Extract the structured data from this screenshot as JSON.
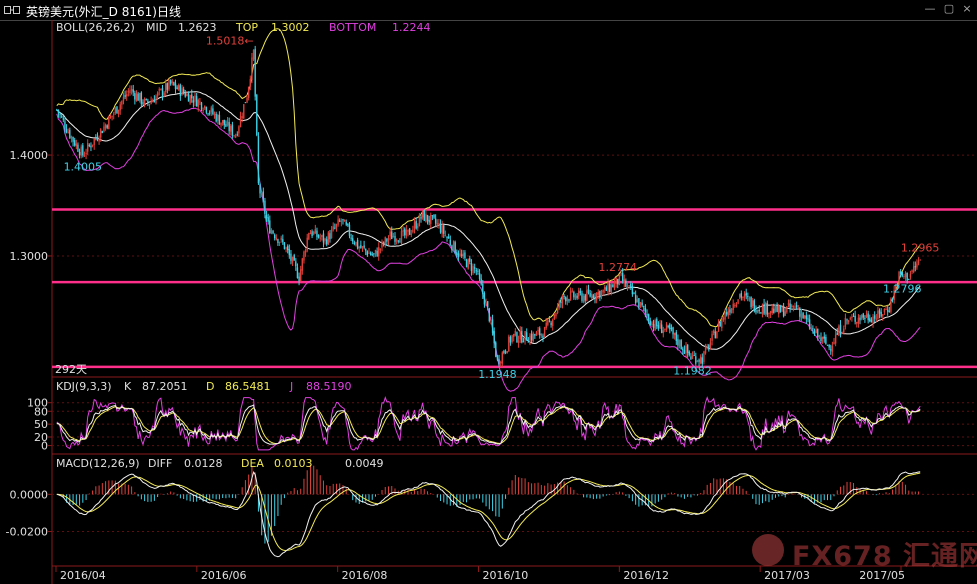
{
  "window": {
    "title": "英镑美元(外汇_D 8161)日线",
    "controls": [
      "—",
      "▢",
      "×"
    ]
  },
  "palette": {
    "up": "#e0413a",
    "down": "#3fd1e6",
    "mid": "#f0f0f0",
    "top": "#f2ea55",
    "bottom": "#e040e0",
    "hline": "#ff2f8a",
    "k": "#f0f0f0",
    "d": "#f2ea55",
    "j": "#e040e0",
    "dea": "#f2ea55",
    "diff": "#f0f0f0",
    "grid": "#5a1010",
    "axis": "#8a1a1a",
    "text": "#e0e0e0",
    "cyan_label": "#3fd1e6",
    "red_label": "#e0413a"
  },
  "panels": {
    "boll": {
      "indicator": "BOLL(26,26,2)",
      "mid_label": "MID",
      "mid_value": "1.2623",
      "top_label": "TOP",
      "top_value": "1.3002",
      "bottom_label": "BOTTOM",
      "bottom_value": "1.2244",
      "period_note": "292天"
    },
    "kdj": {
      "indicator": "KDJ(9,3,3)",
      "k_label": "K",
      "k_value": "87.2051",
      "d_label": "D",
      "d_value": "86.5481",
      "j_label": "J",
      "j_value": "88.5190"
    },
    "macd": {
      "indicator": "MACD(12,26,9)",
      "diff_label": "DIFF",
      "diff_value": "0.0128",
      "dea_label": "DEA",
      "dea_value": "0.0103",
      "macd_value": "0.0049"
    }
  },
  "watermark": {
    "brand": "FX678",
    "cn": "汇通网"
  },
  "chart_data": [
    {
      "type": "candlestick",
      "panel": "BOLL",
      "y_ticks": [
        1.4,
        1.3
      ],
      "y_tick_labels": [
        "1.4000",
        "1.3000"
      ],
      "ylim": [
        1.182,
        1.52
      ],
      "x_tick_labels": [
        "2016/04",
        "2016/06",
        "2016/08",
        "2016/10",
        "2016/12",
        "2017/03",
        "2017/05"
      ],
      "price_path": [
        [
          0,
          1.445
        ],
        [
          10,
          1.415
        ],
        [
          16,
          1.4005
        ],
        [
          30,
          1.43
        ],
        [
          45,
          1.465
        ],
        [
          55,
          1.45
        ],
        [
          70,
          1.47
        ],
        [
          90,
          1.45
        ],
        [
          100,
          1.435
        ],
        [
          110,
          1.42
        ],
        [
          117,
          1.46
        ],
        [
          121,
          1.5018
        ],
        [
          124,
          1.37
        ],
        [
          130,
          1.33
        ],
        [
          140,
          1.31
        ],
        [
          149,
          1.2796
        ],
        [
          155,
          1.325
        ],
        [
          165,
          1.315
        ],
        [
          175,
          1.335
        ],
        [
          185,
          1.31
        ],
        [
          195,
          1.3
        ],
        [
          205,
          1.32
        ],
        [
          215,
          1.32
        ],
        [
          225,
          1.34
        ],
        [
          235,
          1.33
        ],
        [
          248,
          1.3
        ],
        [
          258,
          1.285
        ],
        [
          266,
          1.24
        ],
        [
          271,
          1.1948
        ],
        [
          280,
          1.22
        ],
        [
          292,
          1.22
        ],
        [
          300,
          1.225
        ],
        [
          312,
          1.26
        ],
        [
          325,
          1.26
        ],
        [
          337,
          1.265
        ],
        [
          347,
          1.2774
        ],
        [
          357,
          1.255
        ],
        [
          367,
          1.232
        ],
        [
          377,
          1.225
        ],
        [
          390,
          1.2
        ],
        [
          397,
          1.1982
        ],
        [
          410,
          1.24
        ],
        [
          420,
          1.262
        ],
        [
          430,
          1.25
        ],
        [
          445,
          1.245
        ],
        [
          455,
          1.25
        ],
        [
          465,
          1.225
        ],
        [
          475,
          1.21
        ],
        [
          485,
          1.235
        ],
        [
          495,
          1.24
        ],
        [
          505,
          1.24
        ],
        [
          512,
          1.25
        ],
        [
          518,
          1.28
        ],
        [
          524,
          1.28
        ],
        [
          531,
          1.2965
        ]
      ],
      "annotations": [
        {
          "text": "1.5018←",
          "value": 1.5018,
          "color": "red"
        },
        {
          "text": "1.4005",
          "value": 1.4005,
          "color": "cyan"
        },
        {
          "text": "1.2796",
          "value": 1.2796,
          "color": "cyan"
        },
        {
          "text": "1.1948",
          "value": 1.1948,
          "color": "cyan"
        },
        {
          "text": "1.2774",
          "value": 1.2774,
          "color": "red"
        },
        {
          "text": "1.1982",
          "value": 1.1982,
          "color": "cyan"
        },
        {
          "text": "1.2965",
          "value": 1.2965,
          "color": "red"
        }
      ],
      "horizontal_lines": [
        1.346,
        1.274,
        1.19
      ]
    },
    {
      "type": "line",
      "panel": "KDJ",
      "y_ticks": [
        100,
        80,
        50,
        20,
        0
      ],
      "ylim": [
        -15,
        118
      ],
      "series": [
        "K",
        "D",
        "J"
      ],
      "last": {
        "K": 87.2051,
        "D": 86.5481,
        "J": 88.519
      }
    },
    {
      "type": "bar",
      "panel": "MACD",
      "y_ticks": [
        0.0,
        -0.02
      ],
      "y_tick_labels": [
        "0.0000",
        "-0.0200"
      ],
      "ylim": [
        -0.038,
        0.012
      ],
      "series": [
        "DIFF",
        "DEA",
        "MACD"
      ],
      "last": {
        "DIFF": 0.0128,
        "DEA": 0.0103,
        "MACD": 0.0049
      }
    }
  ]
}
